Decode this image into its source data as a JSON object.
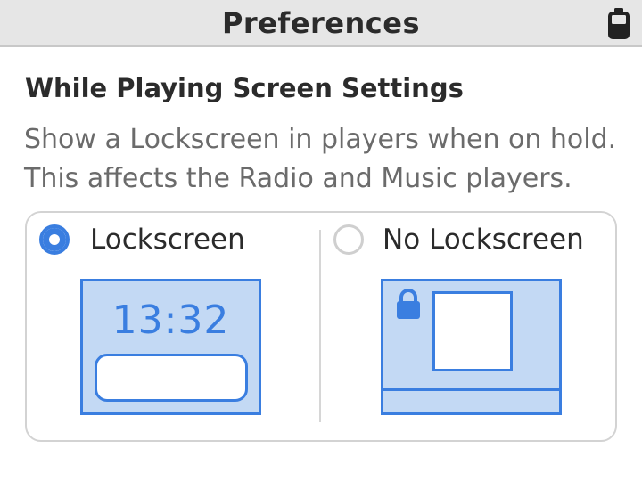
{
  "header": {
    "title": "Preferences",
    "battery_icon": "battery-icon"
  },
  "section": {
    "title": "While Playing Screen Settings",
    "description_line1": "Show a Lockscreen in players when on hold.",
    "description_line2": "This affects the Radio and Music players."
  },
  "options": [
    {
      "label": "Lockscreen",
      "selected": true,
      "preview_icon": "lockscreen-preview-icon",
      "preview_time": "13:32"
    },
    {
      "label": "No Lockscreen",
      "selected": false,
      "preview_icon": "no-lockscreen-preview-icon"
    }
  ],
  "colors": {
    "accent": "#3a7ee0",
    "preview_fill": "#c3d9f4",
    "header_bg": "#e6e6e6",
    "text": "#2b2b2b",
    "muted_text": "#6b6b6b"
  }
}
